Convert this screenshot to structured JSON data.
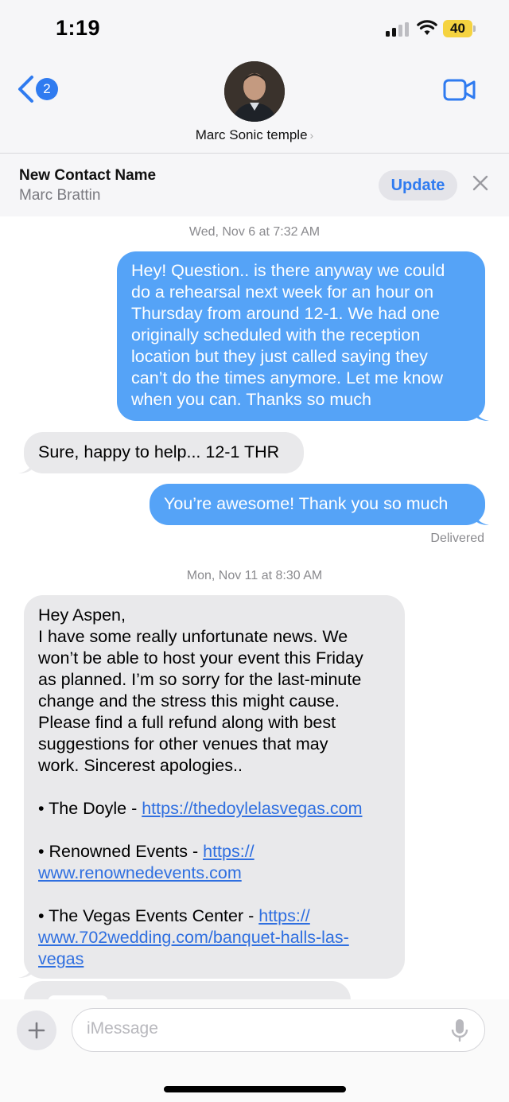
{
  "status_bar": {
    "time": "1:19",
    "battery": "40"
  },
  "header": {
    "back_badge": "2",
    "contact_name": "Marc Sonic temple",
    "contact_chevron": "›"
  },
  "banner": {
    "title": "New Contact Name",
    "subtitle": "Marc Brattin",
    "update_label": "Update"
  },
  "messages": {
    "date1": "Wed, Nov 6 at 7:32 AM",
    "msg1_lines": [
      "Hey! Question.. is there anyway we could",
      "do a rehearsal next week for an hour on",
      "Thursday from around 12-1. We had one",
      "originally scheduled with the reception",
      "location but they just called saying they",
      "can’t do the times anymore. Let me know",
      "when you can. Thanks so much"
    ],
    "msg2": "Sure, happy to help... 12-1 THR",
    "msg3": "You’re awesome! Thank you so much",
    "delivered": "Delivered",
    "date2": "Mon, Nov 11 at 8:30 AM",
    "msg4_lines": [
      "Hey Aspen,",
      "I have some really unfortunate news. We",
      "won’t be able to host your event this Friday",
      "as planned. I’m so sorry for the last-minute",
      "change and the stress this might cause.",
      "Please find a full refund along with best",
      "suggestions for other venues that may",
      "work. Sincerest apologies.."
    ],
    "venue1_name": "• The Doyle - ",
    "venue1_link": "https://thedoylelasvegas.com",
    "venue2_name": "• Renowned Events - ",
    "venue2_link_a": "https://",
    "venue2_link_b": "www.renownedevents.com",
    "venue3_name": "• The Vegas Events Center - ",
    "venue3_link_a": "https://",
    "venue3_link_b": "www.702wedding.com/banquet-halls-las-",
    "venue3_link_c": "vegas"
  },
  "composer": {
    "placeholder": "iMessage"
  },
  "colors": {
    "outgoing": "#55a3f7",
    "incoming": "#e9e9eb",
    "accent": "#2f7bf0"
  },
  "icons": [
    "signal-icon",
    "wifi-icon",
    "battery-icon",
    "back-chevron-icon",
    "video-call-icon",
    "close-icon",
    "plus-icon",
    "microphone-icon"
  ]
}
